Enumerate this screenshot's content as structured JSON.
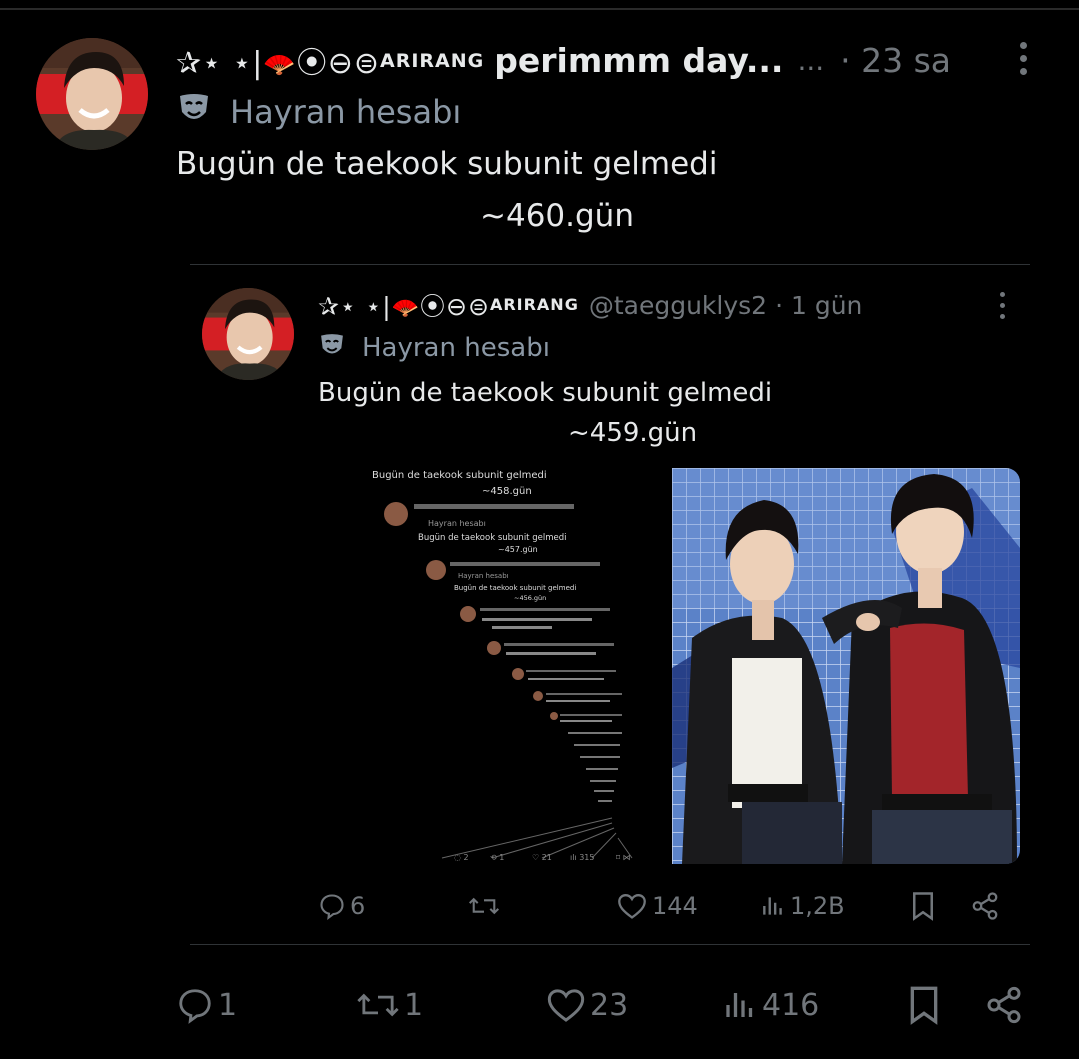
{
  "main_tweet": {
    "name_decoration": "✰⋆ ⋆|",
    "name_circles": "⦿⊖⊜",
    "name_super": "ARIRANG",
    "display_name": "perimmm day...",
    "ellipsis": "...",
    "time": "· 23 sa",
    "fan_label": "Hayran hesabı",
    "text_line1": "Bugün de taekook subunit gelmedi",
    "text_line2": "~460.gün",
    "actions": {
      "replies": "1",
      "reposts": "1",
      "likes": "23",
      "views": "416"
    }
  },
  "quoted_tweet": {
    "name_decoration": "✰⋆ ⋆|",
    "name_circles": "⦿⊖⊜",
    "name_super": "ARIRANG",
    "handle": "@taegguklys2",
    "time": "· 1 gün",
    "fan_label": "Hayran hesabı",
    "text_line1": "Bugün de taekook subunit gelmedi",
    "text_line2": "~459.gün",
    "media_left_lines": [
      "Bugün de taekook subunit gelmedi",
      "~458.gün",
      "Hayran hesabı",
      "Bugün de taekook subunit gelmedi",
      "~457.gün",
      "Hayran hesabı",
      "Bugün de taekook subunit gelmedi",
      "~456.gün"
    ],
    "actions": {
      "replies": "6",
      "likes": "144",
      "views": "1,2B"
    }
  },
  "colors": {
    "background": "#000000",
    "text": "#e7e9ea",
    "muted": "#71767b",
    "fan_icon": "#8b98a5",
    "accent_red": "#e0202a"
  },
  "icons": [
    "more-icon",
    "mask-icon",
    "reply-icon",
    "repost-icon",
    "like-icon",
    "views-icon",
    "bookmark-icon",
    "share-icon"
  ]
}
